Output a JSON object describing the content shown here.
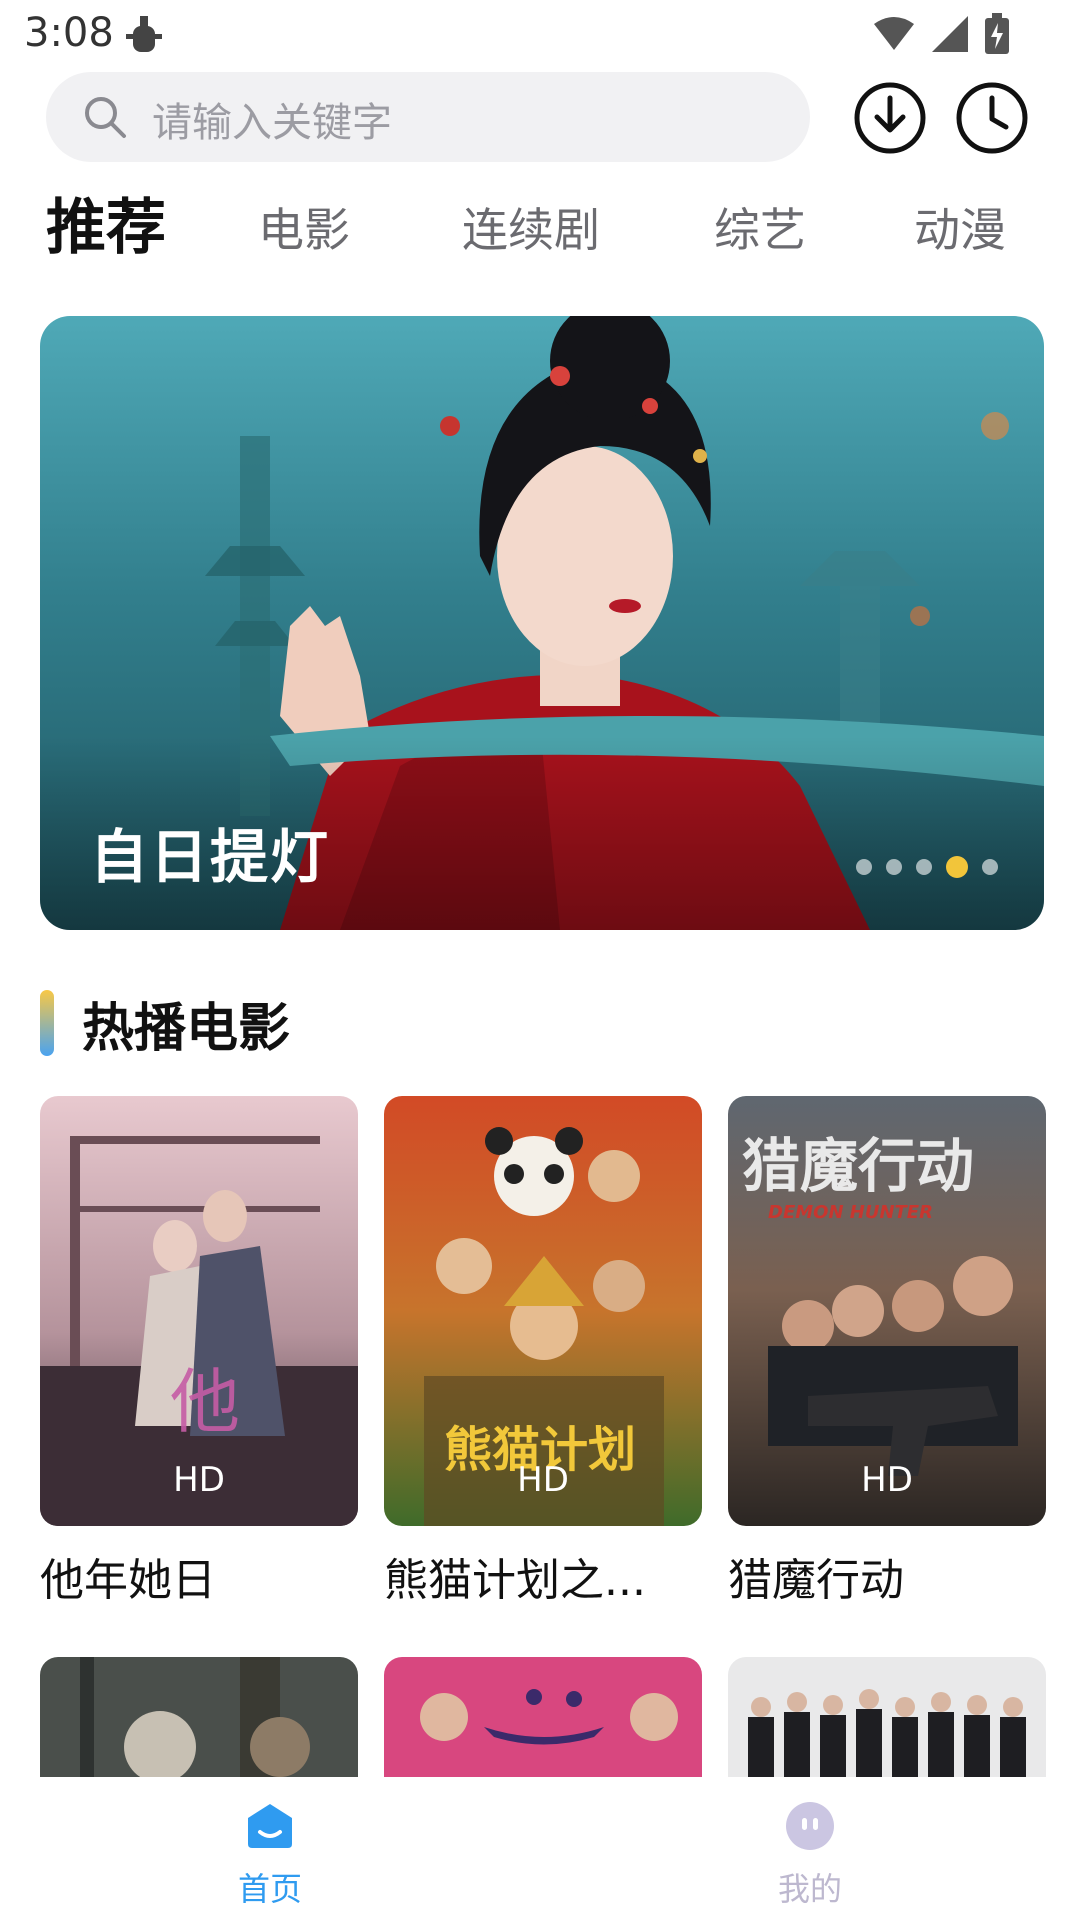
{
  "status_bar": {
    "time": "3:08"
  },
  "search": {
    "placeholder": "请输入关键字"
  },
  "tabs": [
    {
      "label": "推荐",
      "active": true
    },
    {
      "label": "电影",
      "active": false
    },
    {
      "label": "连续剧",
      "active": false
    },
    {
      "label": "综艺",
      "active": false
    },
    {
      "label": "动漫",
      "active": false
    }
  ],
  "banner": {
    "title": "自日提灯",
    "page_count": 5,
    "active_index": 3
  },
  "section": {
    "title": "热播电影"
  },
  "movies": [
    {
      "title": "他年她日",
      "badge": "HD"
    },
    {
      "title": "熊猫计划之...",
      "badge": "HD"
    },
    {
      "title": "猎魔行动",
      "badge": "HD"
    }
  ],
  "bottom_nav": [
    {
      "label": "首页",
      "active": true
    },
    {
      "label": "我的",
      "active": false
    }
  ],
  "colors": {
    "accent": "#2f9bf0",
    "inactive_nav": "#c9c3e0",
    "banner_dot_active": "#f2c53a"
  }
}
